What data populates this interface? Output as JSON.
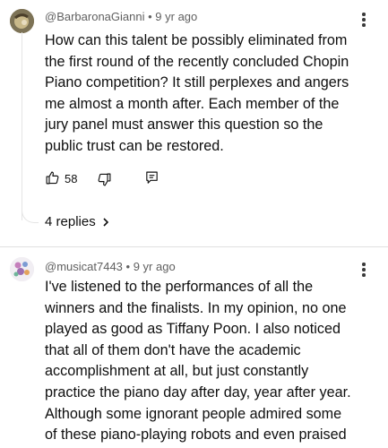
{
  "comments": [
    {
      "author": "@BarbaronaGianni",
      "age": "9 yr ago",
      "lines": [
        "How can this talent be possibly eliminated from",
        "the first round of the recently concluded Chopin",
        "Piano competition?   It still perplexes and angers",
        "me almost a month after.  Each member of the",
        "jury panel must answer this question so the",
        "public trust can be restored."
      ],
      "likes": "58",
      "replies_label": "4 replies"
    },
    {
      "author": "@musicat7443",
      "age": "9 yr ago",
      "lines": [
        "I've listened to the performances of all the",
        "winners and the finalists. In my opinion, no one",
        "played as good as Tiffany Poon. I also noticed",
        "that all of them don't have the academic",
        "accomplishment at all, but just constantly",
        "practice the piano day after day, year after year.",
        "Although some ignorant people admired some",
        "of these piano-playing robots and even praised"
      ]
    }
  ],
  "separator": "•",
  "icons": {
    "like": "thumbs-up-icon",
    "dislike": "thumbs-down-icon",
    "reply": "reply-icon",
    "more": "more-vertical-icon",
    "chevron": "chevron-right-icon"
  }
}
